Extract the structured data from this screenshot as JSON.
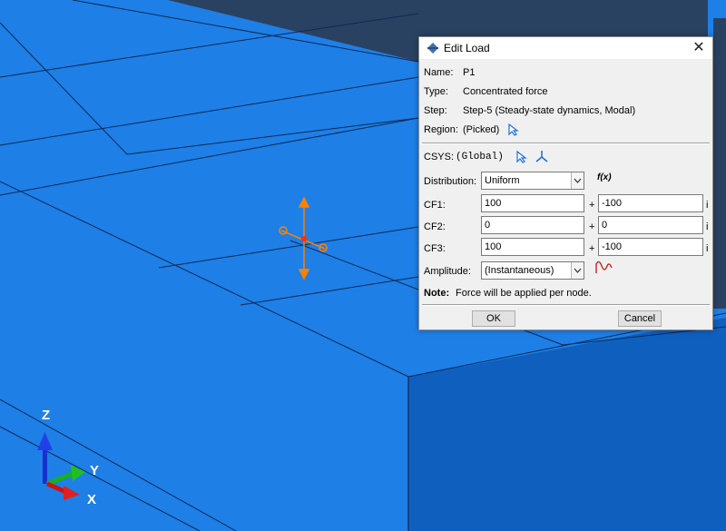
{
  "dialog": {
    "title": "Edit Load",
    "close_glyph": "✕",
    "name_label": "Name:",
    "name_value": "P1",
    "type_label": "Type:",
    "type_value": "Concentrated force",
    "step_label": "Step:",
    "step_value": "Step-5 (Steady-state dynamics, Modal)",
    "region_label": "Region:",
    "region_value": "(Picked)",
    "csys_label": "CSYS:",
    "csys_value": "(Global)",
    "distribution_label": "Distribution:",
    "distribution_value": "Uniform",
    "fx_label": "f(x)",
    "cf_rows": [
      {
        "label": "CF1:",
        "real": "100",
        "imag": "-100"
      },
      {
        "label": "CF2:",
        "real": "0",
        "imag": "0"
      },
      {
        "label": "CF3:",
        "real": "100",
        "imag": "-100"
      }
    ],
    "plus_sign": "+",
    "imag_unit": "i",
    "amplitude_label": "Amplitude:",
    "amplitude_value": "(Instantaneous)",
    "note_label": "Note:",
    "note_text": "Force will be applied per node.",
    "ok_label": "OK",
    "cancel_label": "Cancel"
  },
  "triad": {
    "z_label": "Z",
    "y_label": "Y",
    "x_label": "X"
  },
  "colors": {
    "model_top": "#1e7fe6",
    "model_side": "#0f5fbf",
    "dark_block": "#2a4261",
    "load_marker": "#ff8000",
    "pick_icon": "#1a6fe0"
  },
  "icons": [
    "dialog-app-icon",
    "close-icon",
    "pick-arrow-icon",
    "csys-triad-icon",
    "chevron-down-icon",
    "fx-icon",
    "amplitude-wave-icon"
  ]
}
